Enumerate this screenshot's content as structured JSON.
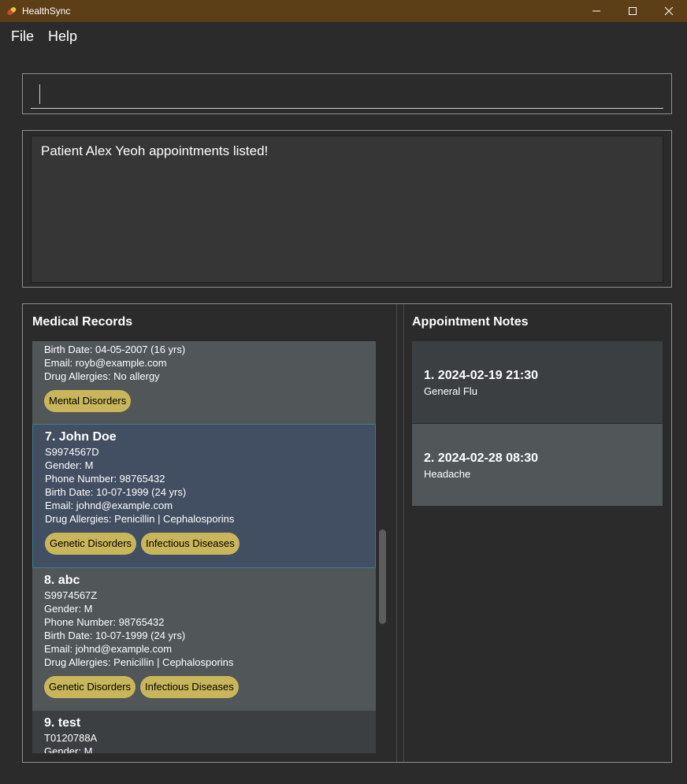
{
  "window": {
    "title": "HealthSync",
    "icon": "pill-icon",
    "controls": [
      "minimize-icon",
      "maximize-icon",
      "close-icon"
    ]
  },
  "menu": {
    "file": "File",
    "help": "Help"
  },
  "command": {
    "value": ""
  },
  "result": {
    "message": "Patient Alex Yeoh appointments listed!"
  },
  "records": {
    "title": "Medical Records",
    "partial_card": {
      "birth": "Birth Date: 04-05-2007 (16 yrs)",
      "email": "Email: royb@example.com",
      "allergies": "Drug Allergies: No allergy",
      "tags": [
        "Mental Disorders"
      ]
    },
    "cards": [
      {
        "name": "7.  John Doe",
        "nric": "S9974567D",
        "gender": "Gender: M",
        "phone": "Phone Number: 98765432",
        "birth": "Birth Date: 10-07-1999 (24 yrs)",
        "email": "Email: johnd@example.com",
        "allergies": "Drug Allergies: Penicillin | Cephalosporins",
        "tags": [
          "Genetic Disorders",
          "Infectious Diseases"
        ]
      },
      {
        "name": "8.  abc",
        "nric": "S9974567Z",
        "gender": "Gender: M",
        "phone": "Phone Number: 98765432",
        "birth": "Birth Date: 10-07-1999 (24 yrs)",
        "email": "Email: johnd@example.com",
        "allergies": "Drug Allergies: Penicillin | Cephalosporins",
        "tags": [
          "Genetic Disorders",
          "Infectious Diseases"
        ]
      },
      {
        "name": "9.  test",
        "nric": "T0120788A",
        "gender": "Gender: M"
      }
    ]
  },
  "appointments": {
    "title": "Appointment Notes",
    "items": [
      {
        "datetime": "1.  2024-02-19 21:30",
        "note": "General Flu"
      },
      {
        "datetime": "2.  2024-02-28 08:30",
        "note": "Headache"
      }
    ]
  }
}
